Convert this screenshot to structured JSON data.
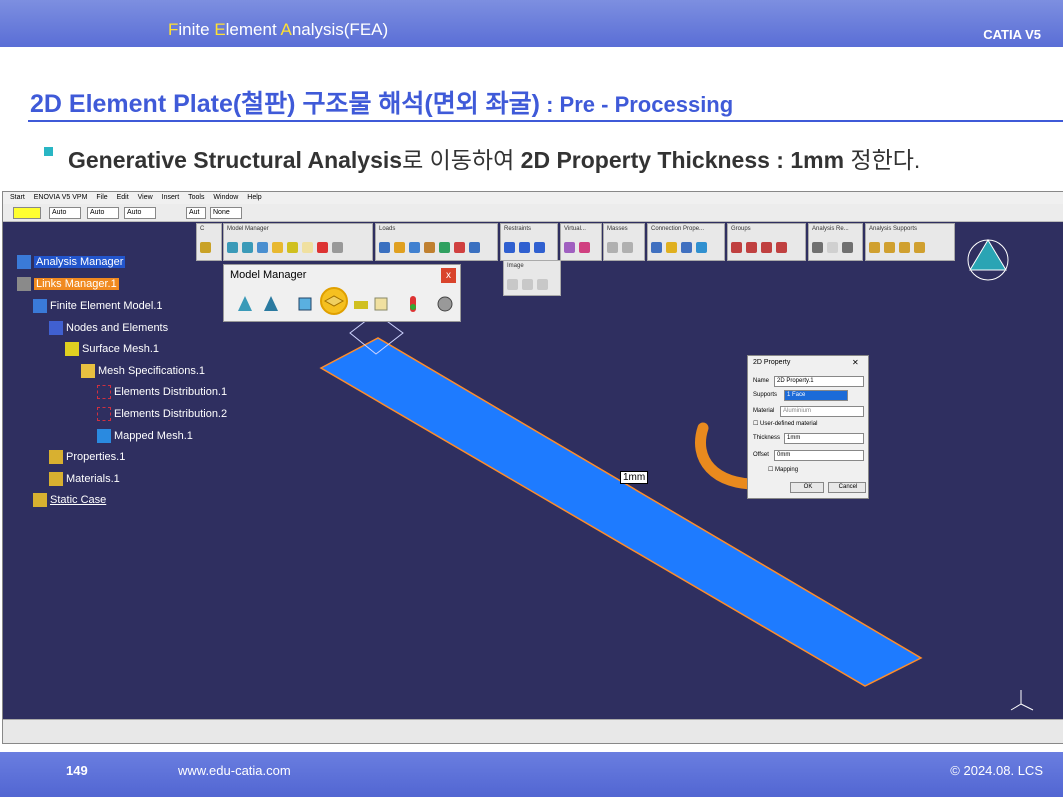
{
  "header": {
    "title_parts": [
      {
        "text": "F",
        "hl": true
      },
      {
        "text": "inite ",
        "hl": false
      },
      {
        "text": "E",
        "hl": true
      },
      {
        "text": "lement ",
        "hl": false
      },
      {
        "text": "A",
        "hl": true
      },
      {
        "text": "nalysis(FEA)",
        "hl": false
      }
    ],
    "brand": "CATIA V5"
  },
  "slide": {
    "title": "2D Element Plate(철판) 구조물 해석(면외 좌굴)",
    "subtitle": " : Pre - Processing",
    "bullet_bold1": "Generative Structural Analysis",
    "bullet_text1": "로 이동하여 ",
    "bullet_bold2": "2D Property Thickness : 1mm",
    "bullet_text2": " 정한다."
  },
  "app": {
    "menu": [
      "Start",
      "ENOVIA V5 VPM",
      "File",
      "Edit",
      "View",
      "Insert",
      "Tools",
      "Window",
      "Help"
    ],
    "combos": [
      "Auto",
      "Auto",
      "Auto",
      "Aut",
      "None"
    ],
    "toolbars": [
      "C",
      "Model Manager",
      "Loads",
      "Restraints",
      "Virtual...",
      "Masses",
      "Connection Prope...",
      "Groups",
      "Analysis Re...",
      "Analysis Supports"
    ],
    "image_toolbar": "Image",
    "tree": [
      "Analysis Manager",
      "Links Manager.1",
      "Finite Element Model.1",
      "Nodes and Elements",
      "Surface Mesh.1",
      "Mesh Specifications.1",
      "Elements Distribution.1",
      "Elements Distribution.2",
      "Mapped Mesh.1",
      "Properties.1",
      "Materials.1",
      "Static Case"
    ],
    "model_manager": {
      "title": "Model Manager",
      "close": "x"
    },
    "thickness_label": "1mm",
    "property_dialog": {
      "title": "2D Property",
      "name_label": "Name",
      "name_value": "2D Property.1",
      "supports_label": "Supports",
      "supports_value": "1 Face",
      "material_label": "Material",
      "material_value": "Aluminium",
      "user_defined": "User-defined material",
      "thickness_label": "Thickness",
      "thickness_value": "1mm",
      "offset_label": "Offset",
      "offset_value": "0mm",
      "mapping": "Mapping",
      "ok": "OK",
      "cancel": "Cancel"
    }
  },
  "footer": {
    "page": "149",
    "url": "www.edu-catia.com",
    "copyright": "© 2024.08. LCS"
  },
  "colors": {
    "accent": "#3f5ad8",
    "viewport": "#2f2f60",
    "plate": "#1e7bff",
    "plate_edge": "#ff8c2a",
    "highlight": "#ffc107",
    "arrow": "#e98a1e"
  }
}
